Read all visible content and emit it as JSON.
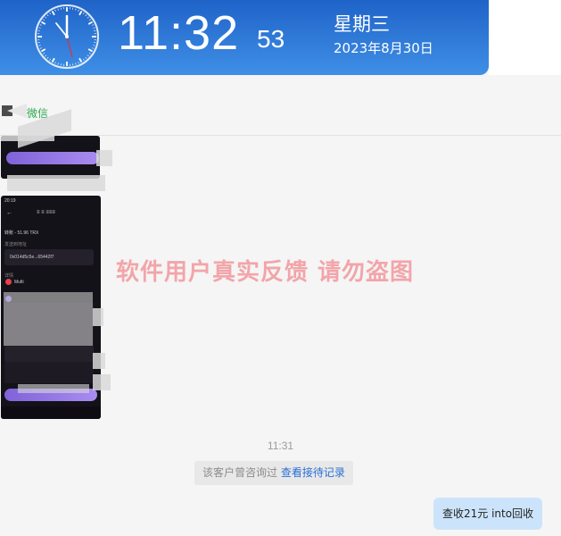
{
  "clock": {
    "time": "11:32",
    "seconds": "53",
    "weekday": "星期三",
    "date": "2023年8月30日"
  },
  "tab": {
    "label": "微信",
    "color": "#2fa84f"
  },
  "chat": {
    "watermark": "软件用户真实反馈  请勿盗图",
    "timestamp": "11:31",
    "system_notice_text": "该客户曾咨询过",
    "system_notice_link": "查看接待记录",
    "outgoing_message": "查收21元 into回收"
  },
  "phone_screenshot": {
    "status_time": "20:19 ",
    "title": "≡ ≡ ≡≡≡",
    "amount": "转账 - 51.96 TRX",
    "address_label": "发送到地址",
    "address": "0x014d5c5e...65442f7",
    "item_label": "详情",
    "network": "Multi"
  },
  "colors": {
    "clock_bar": "#2f7bdc",
    "bubble": "#cce4fb",
    "link": "#2a6fd6",
    "watermark": "#f2a5a9"
  }
}
